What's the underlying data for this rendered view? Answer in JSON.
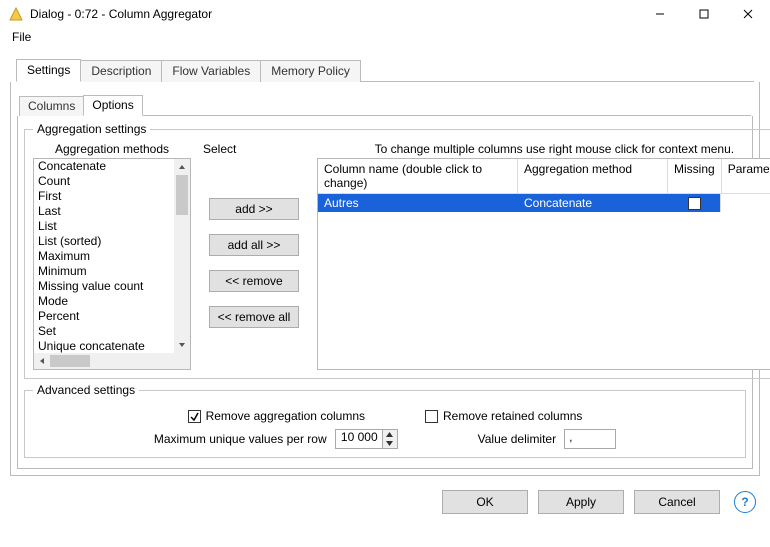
{
  "window": {
    "title": "Dialog - 0:72 - Column Aggregator",
    "minimize": "–",
    "maximize": "▢",
    "close": "✕"
  },
  "menubar": {
    "file": "File"
  },
  "tabs": {
    "settings": "Settings",
    "description": "Description",
    "flow_variables": "Flow Variables",
    "memory_policy": "Memory Policy"
  },
  "inner_tabs": {
    "columns": "Columns",
    "options": "Options"
  },
  "agg": {
    "legend": "Aggregation settings",
    "methods_header": "Aggregation methods",
    "select_header": "Select",
    "hint": "To change multiple columns use right mouse click for context menu.",
    "methods": [
      "Concatenate",
      "Count",
      "First",
      "Last",
      "List",
      "List (sorted)",
      "Maximum",
      "Minimum",
      "Missing value count",
      "Mode",
      "Percent",
      "Set",
      "Unique concatenate"
    ],
    "buttons": {
      "add": "add >>",
      "add_all": "add all >>",
      "remove": "<< remove",
      "remove_all": "<< remove all"
    },
    "table": {
      "col_name": "Column name (double click to change)",
      "col_method": "Aggregation method",
      "col_missing": "Missing",
      "col_param": "Parameter",
      "rows": [
        {
          "name": "Autres",
          "method": "Concatenate",
          "missing": false,
          "param": ""
        }
      ]
    }
  },
  "advanced": {
    "legend": "Advanced settings",
    "remove_agg": {
      "label": "Remove aggregation columns",
      "checked": true
    },
    "remove_ret": {
      "label": "Remove retained columns",
      "checked": false
    },
    "max_unique": {
      "label": "Maximum unique values per row",
      "value": "10 000"
    },
    "delimiter": {
      "label": "Value delimiter",
      "value": ","
    }
  },
  "footer": {
    "ok": "OK",
    "apply": "Apply",
    "cancel": "Cancel",
    "help": "?"
  }
}
